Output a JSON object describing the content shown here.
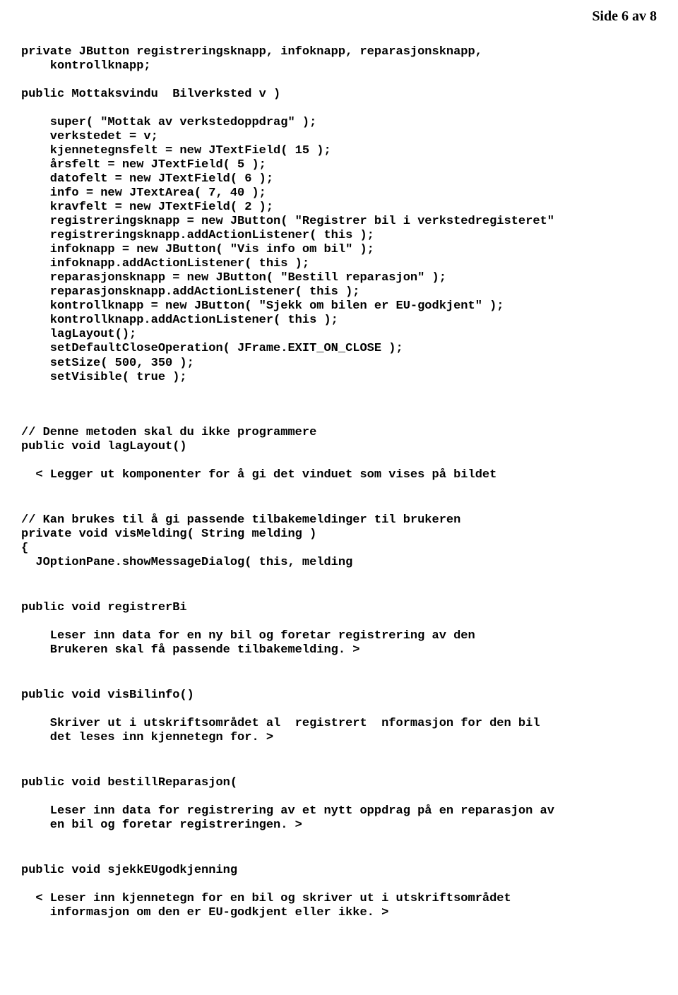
{
  "page_header": "Side 6 av 8",
  "b1": "private JButton registreringsknapp, infoknapp, reparasjonsknapp,\n    kontrollknapp;",
  "b2": "public Mottaksvindu  Bilverksted v )",
  "b3": "    super( \"Mottak av verkstedoppdrag\" );\n    verkstedet = v;\n    kjennetegnsfelt = new JTextField( 15 );\n    årsfelt = new JTextField( 5 );\n    datofelt = new JTextField( 6 );\n    info = new JTextArea( 7, 40 );\n    kravfelt = new JTextField( 2 );\n    registreringsknapp = new JButton( \"Registrer bil i verkstedregisteret\"\n    registreringsknapp.addActionListener( this );\n    infoknapp = new JButton( \"Vis info om bil\" );\n    infoknapp.addActionListener( this );\n    reparasjonsknapp = new JButton( \"Bestill reparasjon\" );\n    reparasjonsknapp.addActionListener( this );\n    kontrollknapp = new JButton( \"Sjekk om bilen er EU-godkjent\" );\n    kontrollknapp.addActionListener( this );\n    lagLayout();\n    setDefaultCloseOperation( JFrame.EXIT_ON_CLOSE );\n    setSize( 500, 350 );\n    setVisible( true );",
  "b4": "// Denne metoden skal du ikke programmere\npublic void lagLayout()",
  "b5": "  < Legger ut komponenter for å gi det vinduet som vises på bildet",
  "b6": "// Kan brukes til å gi passende tilbakemeldinger til brukeren\nprivate void visMelding( String melding )\n{\n  JOptionPane.showMessageDialog( this, melding",
  "b7": "public void registrerBi",
  "b8": "    Leser inn data for en ny bil og foretar registrering av den\n    Brukeren skal få passende tilbakemelding. >",
  "b9": "public void visBilinfo()",
  "b10": "    Skriver ut i utskriftsområdet al  registrert  nformasjon for den bil\n    det leses inn kjennetegn for. >",
  "b11": "public void bestillReparasjon(",
  "b12": "    Leser inn data for registrering av et nytt oppdrag på en reparasjon av\n    en bil og foretar registreringen. >",
  "b13": "public void sjekkEUgodkjenning",
  "b14": "  < Leser inn kjennetegn for en bil og skriver ut i utskriftsområdet\n    informasjon om den er EU-godkjent eller ikke. >"
}
